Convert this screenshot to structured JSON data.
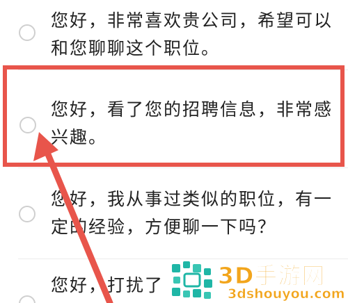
{
  "options": [
    {
      "text": "您好，非常喜欢贵公司，希望可以和您聊聊这个职位。"
    },
    {
      "text": "您好，看了您的招聘信息，非常感兴趣。"
    },
    {
      "text": "您好，我从事过类似的职位，有一定的经验，方便聊一下吗？"
    },
    {
      "text": "您好，打扰了"
    }
  ],
  "watermark": {
    "title": "3D手游网",
    "url": "3dshouyou.com"
  },
  "colors": {
    "highlight": "#e8554b",
    "watermark_orange": "#f2a51c",
    "watermark_green": "#1fb6a6"
  }
}
